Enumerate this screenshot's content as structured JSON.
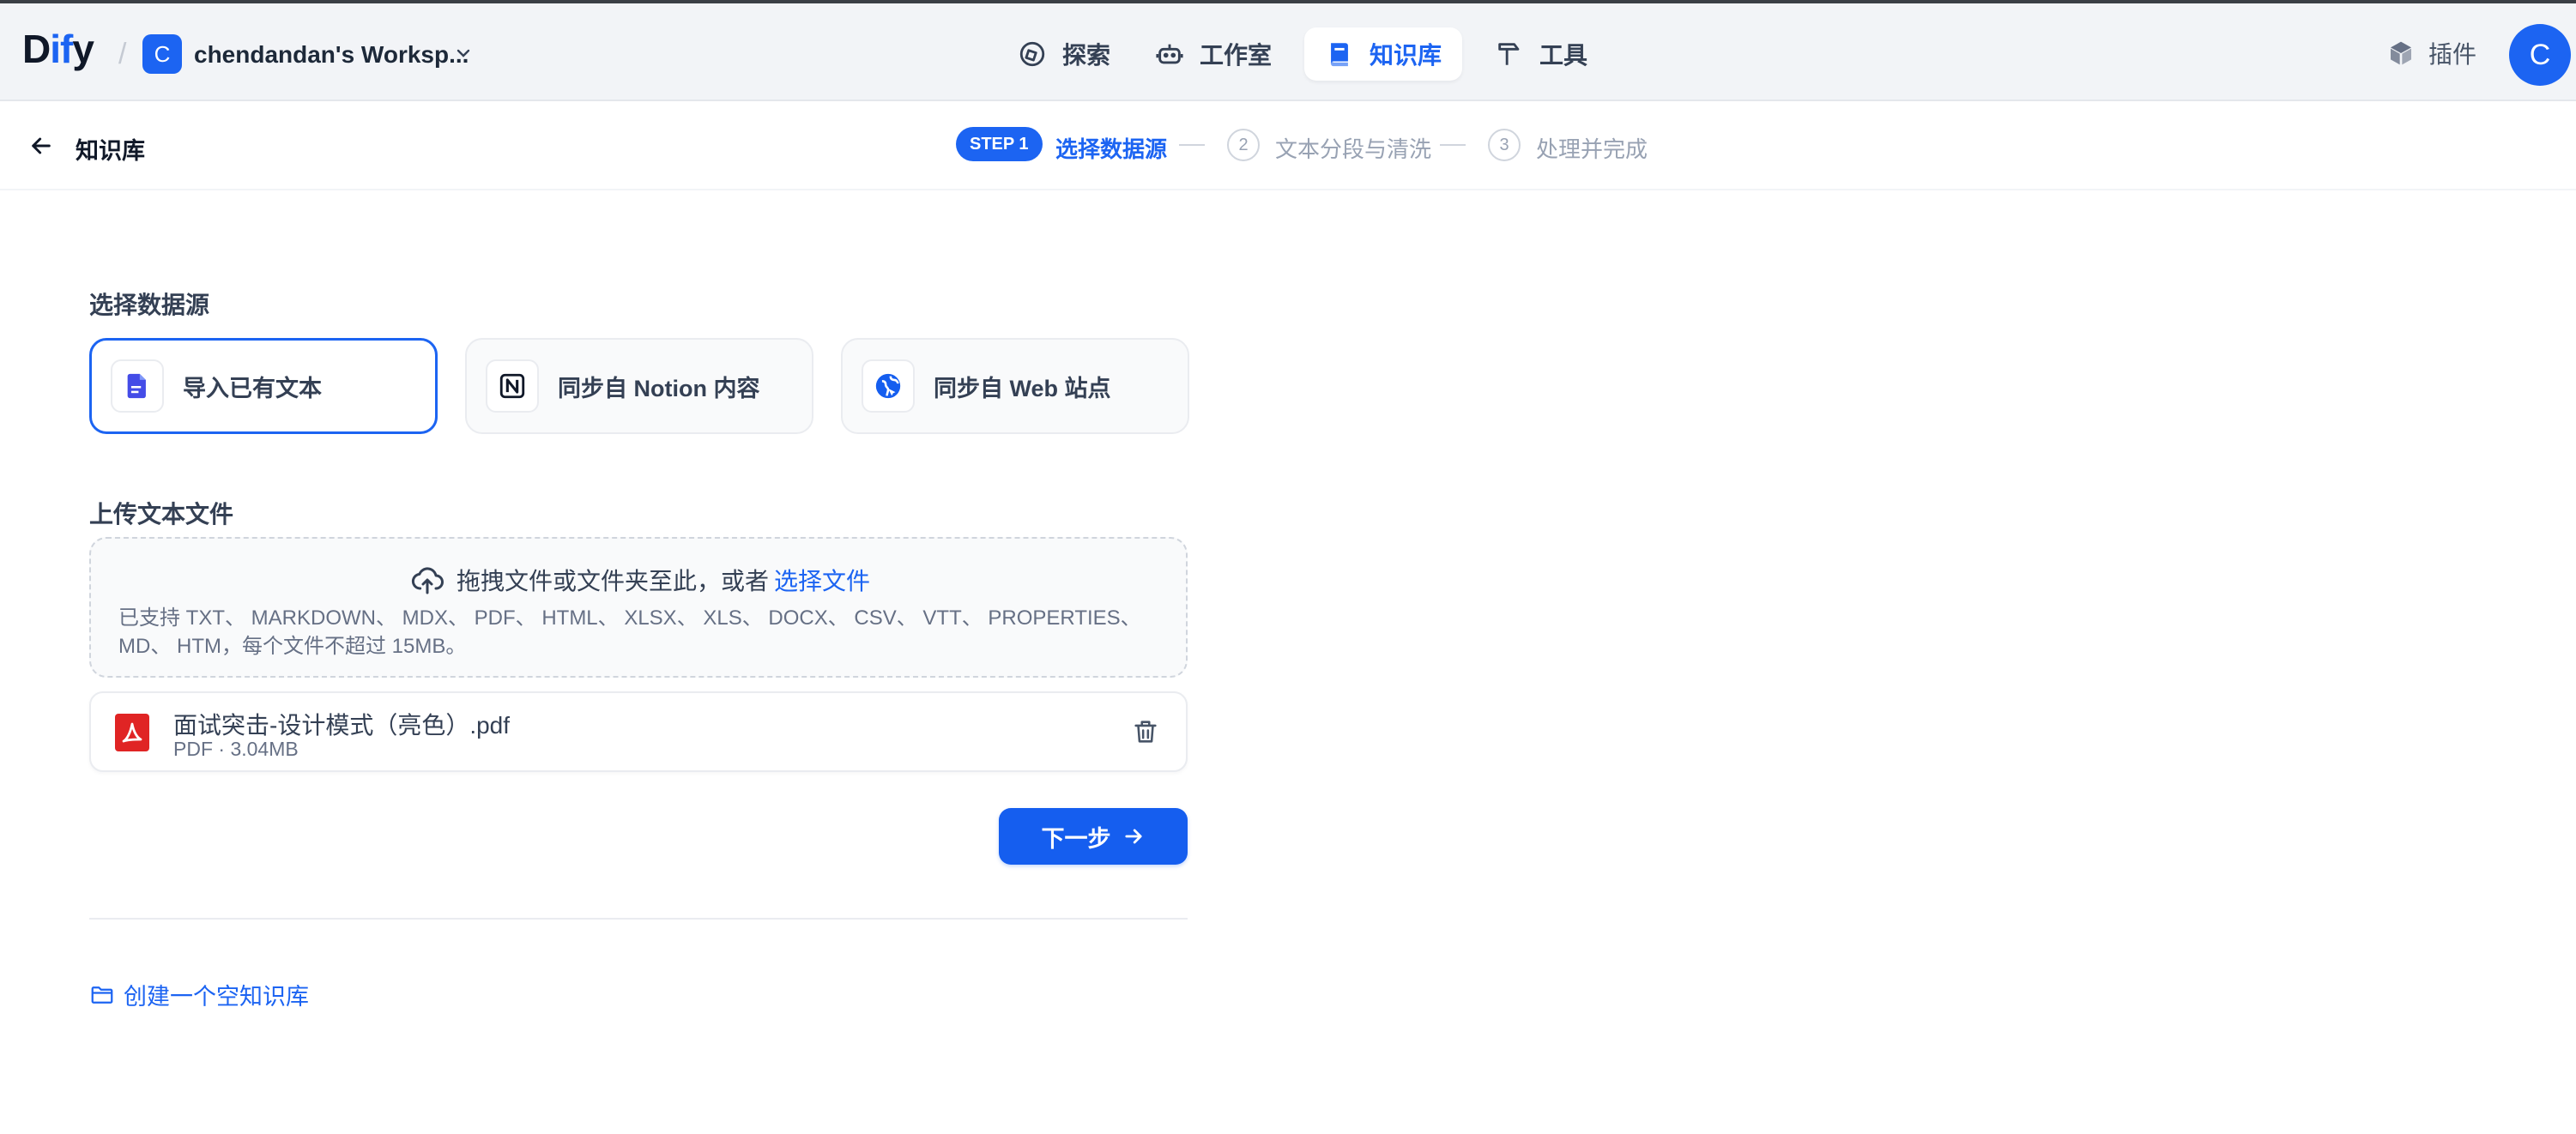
{
  "topbar": {
    "logo": {
      "prefix": "D",
      "accent": "if",
      "suffix": "y"
    },
    "slash": "/",
    "workspace": {
      "avatar_letter": "C",
      "name": "chendandan's Worksp..."
    },
    "nav": [
      {
        "label": "探索",
        "icon": "compass-icon"
      },
      {
        "label": "工作室",
        "icon": "robot-icon"
      },
      {
        "label": "知识库",
        "icon": "book-icon",
        "active": true
      },
      {
        "label": "工具",
        "icon": "hammer-icon"
      }
    ],
    "plugin_label": "插件",
    "user_avatar_letter": "C"
  },
  "subbar": {
    "back_label": "知识库",
    "steps": [
      {
        "badge": "STEP 1",
        "label": "选择数据源"
      },
      {
        "number": "2",
        "label": "文本分段与清洗"
      },
      {
        "number": "3",
        "label": "处理并完成"
      }
    ]
  },
  "datasource": {
    "title": "选择数据源",
    "options": [
      {
        "label": "导入已有文本",
        "icon": "file-text-icon"
      },
      {
        "label": "同步自 Notion 内容",
        "icon": "notion-icon"
      },
      {
        "label": "同步自 Web 站点",
        "icon": "web-icon"
      }
    ]
  },
  "upload": {
    "title": "上传文本文件",
    "drop_text": "拖拽文件或文件夹至此，或者",
    "drop_link": "选择文件",
    "hint": "已支持 TXT、 MARKDOWN、 MDX、 PDF、 HTML、 XLSX、 XLS、 DOCX、 CSV、 VTT、 PROPERTIES、 MD、 HTM，每个文件不超过 15MB。",
    "file": {
      "name": "面试突击-设计模式（亮色）.pdf",
      "meta": "PDF · 3.04MB"
    }
  },
  "next_button": "下一步",
  "create_empty": "创建一个空知识库",
  "colors": {
    "accent": "#1c64f2",
    "button": "#155eef",
    "pdf": "#e02424"
  }
}
